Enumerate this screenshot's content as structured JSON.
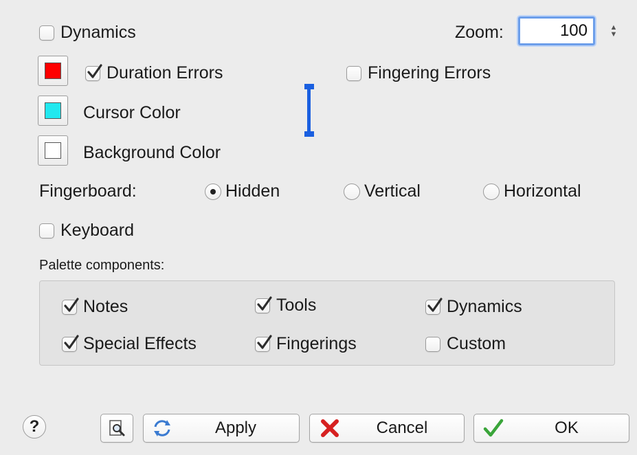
{
  "top": {
    "dynamics_label": "Dynamics",
    "zoom_label": "Zoom:",
    "zoom_value": "100"
  },
  "colors": {
    "duration_errors_label": "Duration Errors",
    "fingering_errors_label": "Fingering Errors",
    "cursor_color_label": "Cursor Color",
    "background_color_label": "Background Color",
    "duration_swatch": "#ff0000",
    "cursor_swatch": "#22e8ef",
    "background_swatch": "#ffffff",
    "cursor_preview": "#1a5fe0"
  },
  "fingerboard": {
    "label": "Fingerboard:",
    "options": [
      "Hidden",
      "Vertical",
      "Horizontal"
    ],
    "selected": "Hidden"
  },
  "keyboard_label": "Keyboard",
  "palette": {
    "title": "Palette components:",
    "items": [
      "Notes",
      "Tools",
      "Dynamics",
      "Special Effects",
      "Fingerings",
      "Custom"
    ]
  },
  "buttons": {
    "help": "?",
    "apply": "Apply",
    "cancel": "Cancel",
    "ok": "OK"
  }
}
